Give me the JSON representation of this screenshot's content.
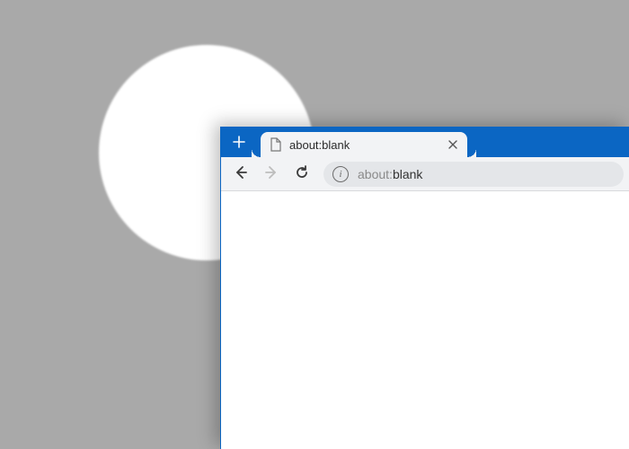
{
  "tabstrip": {
    "tab_title": "about:blank"
  },
  "toolbar": {
    "url_scheme": "about:",
    "url_rest": "blank"
  },
  "icons": {
    "new_tab": "plus-icon",
    "favicon": "file-icon",
    "close_tab": "close-icon",
    "nav_back": "arrow-left-icon",
    "nav_forward": "arrow-right-icon",
    "reload": "reload-icon",
    "site_info": "info-icon"
  },
  "colors": {
    "frame": "#0b66c3",
    "toolbar": "#f2f3f5",
    "backdrop": "#a9a9a9"
  }
}
